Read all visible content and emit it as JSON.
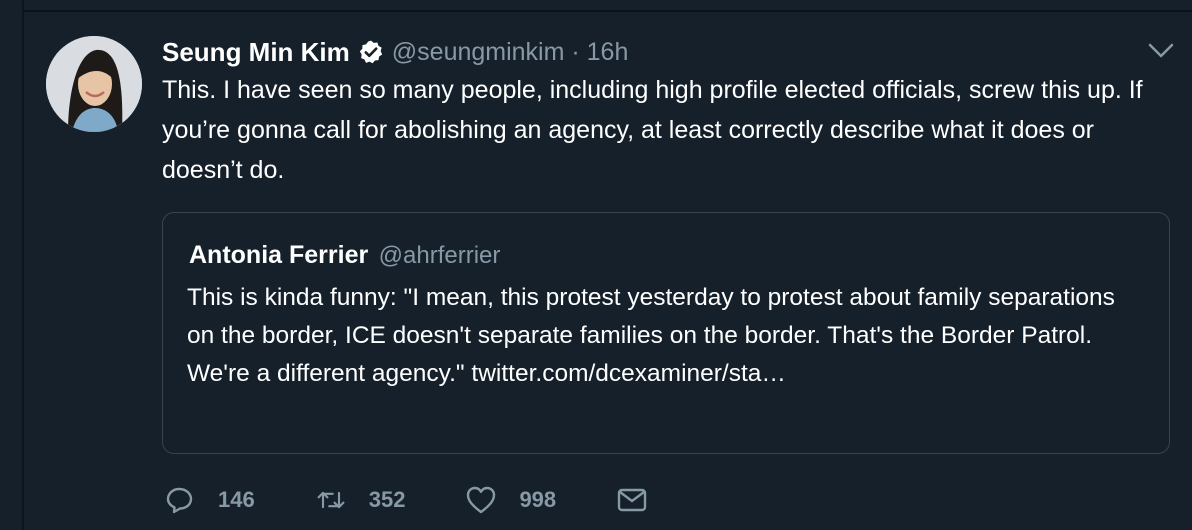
{
  "tweet": {
    "author_name": "Seung Min Kim",
    "handle_time": "@seungminkim · 16h",
    "text": "This. I have seen so many people, including high profile elected officials, screw this up. If you’re gonna call for abolishing an agency, at least correctly describe what it does or doesn’t do.",
    "verified": true
  },
  "quote": {
    "author_name": "Antonia Ferrier",
    "handle": "@ahrferrier",
    "text": "This is kinda funny:  \"I mean, this protest yesterday to protest about family separations on the border, ICE doesn't separate families on the border. That's the Border Patrol. We're a different agency.\" twitter.com/dcexaminer/sta…"
  },
  "actions": {
    "replies": "146",
    "retweets": "352",
    "likes": "998"
  },
  "colors": {
    "background": "#15202b",
    "secondary_text": "#8899a6",
    "border": "#38444d",
    "verified_badge": "#ffffff"
  },
  "icons": [
    "verified-badge-icon",
    "chevron-down-icon",
    "reply-icon",
    "retweet-icon",
    "like-icon",
    "message-icon"
  ]
}
